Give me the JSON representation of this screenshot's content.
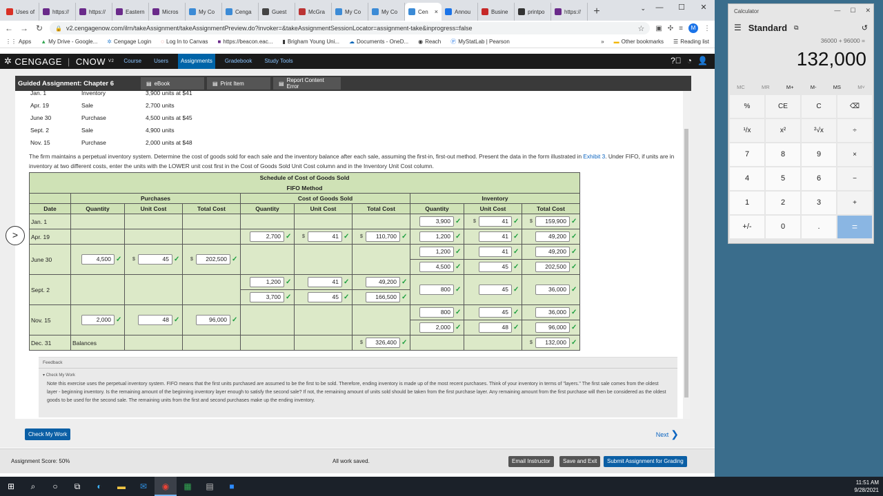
{
  "browser": {
    "tabs": [
      {
        "label": "Uses of",
        "color": "#d93025"
      },
      {
        "label": "https://",
        "color": "#6a2a8a"
      },
      {
        "label": "https://",
        "color": "#6a2a8a"
      },
      {
        "label": "Eastern",
        "color": "#6a2a8a"
      },
      {
        "label": "Micros",
        "color": "#6a2a8a"
      },
      {
        "label": "My Co",
        "color": "#3c8bd6"
      },
      {
        "label": "Cenga",
        "color": "#3c8bd6"
      },
      {
        "label": "Guest",
        "color": "#444"
      },
      {
        "label": "McGra",
        "color": "#b33"
      },
      {
        "label": "My Co",
        "color": "#3c8bd6"
      },
      {
        "label": "My Co",
        "color": "#3c8bd6"
      },
      {
        "label": "Cen",
        "color": "#3c8bd6",
        "active": true
      },
      {
        "label": "Annou",
        "color": "#1a73e8"
      },
      {
        "label": "Busine",
        "color": "#c62828"
      },
      {
        "label": "printpo",
        "color": "#333"
      },
      {
        "label": "https://",
        "color": "#6a2a8a"
      }
    ],
    "url": "v2.cengagenow.com/ilrn/takeAssignment/takeAssignmentPreview.do?invoker=&takeAssignmentSessionLocator=assignment-take&inprogress=false",
    "profile_initial": "M",
    "bookmarks": [
      "Apps",
      "My Drive - Google...",
      "Cengage Login",
      "Log In to Canvas",
      "https://beacon.eac...",
      "Brigham Young Uni...",
      "Documents - OneD...",
      "Reach",
      "MyStatLab | Pearson"
    ],
    "other_bookmarks": "Other bookmarks",
    "reading_list": "Reading list"
  },
  "cengage": {
    "logo": "CENGAGE",
    "logo2": "CNOW",
    "logo2_sup": "V2",
    "nav": [
      "Course",
      "Users",
      "Assignments",
      "Gradebook",
      "Study Tools"
    ],
    "active_nav": "Assignments",
    "assignment_title": "Guided Assignment: Chapter 6",
    "ebook": "eBook",
    "print_item": "Print Item",
    "report_error": "Report Content Error"
  },
  "transactions": [
    {
      "date": "Jan. 1",
      "type": "Inventory",
      "detail": "3,900 units at $41"
    },
    {
      "date": "Apr. 19",
      "type": "Sale",
      "detail": "2,700 units"
    },
    {
      "date": "June 30",
      "type": "Purchase",
      "detail": "4,500 units at $45"
    },
    {
      "date": "Sept. 2",
      "type": "Sale",
      "detail": "4,900 units"
    },
    {
      "date": "Nov. 15",
      "type": "Purchase",
      "detail": "2,000 units at $48"
    }
  ],
  "instructions": {
    "text1": "The firm maintains a perpetual inventory system. Determine the cost of goods sold for each sale and the inventory balance after each sale, assuming the first-in, first-out method. Present the data in the form illustrated in ",
    "link": "Exhibit 3",
    "text2": ". Under FIFO, if units are in inventory at two different costs, enter the units with the LOWER unit cost first in the Cost of Goods Sold Unit Cost column and in the Inventory Unit Cost column."
  },
  "schedule": {
    "title": "Schedule of Cost of Goods Sold",
    "subtitle": "FIFO Method",
    "groups": [
      "Purchases",
      "Cost of Goods Sold",
      "Inventory"
    ],
    "columns": [
      "Date",
      "Quantity",
      "Unit Cost",
      "Total Cost",
      "Quantity",
      "Unit Cost",
      "Total Cost",
      "Quantity",
      "Unit Cost",
      "Total Cost"
    ],
    "dollar": "$",
    "check": "✓",
    "jan1": {
      "date": "Jan. 1",
      "inv_qty": "3,900",
      "inv_uc": "41",
      "inv_tc": "159,900"
    },
    "apr19": {
      "date": "Apr. 19",
      "cogs_qty": "2,700",
      "cogs_uc": "41",
      "cogs_tc": "110,700",
      "inv_qty": "1,200",
      "inv_uc": "41",
      "inv_tc": "49,200"
    },
    "jun30": {
      "date": "June 30",
      "p_qty": "4,500",
      "p_uc": "45",
      "p_tc": "202,500",
      "inv1_qty": "1,200",
      "inv1_uc": "41",
      "inv1_tc": "49,200",
      "inv2_qty": "4,500",
      "inv2_uc": "45",
      "inv2_tc": "202,500"
    },
    "sep2": {
      "date": "Sept. 2",
      "c1_qty": "1,200",
      "c1_uc": "41",
      "c1_tc": "49,200",
      "c2_qty": "3,700",
      "c2_uc": "45",
      "c2_tc": "166,500",
      "inv_qty": "800",
      "inv_uc": "45",
      "inv_tc": "36,000"
    },
    "nov15": {
      "date": "Nov. 15",
      "p_qty": "2,000",
      "p_uc": "48",
      "p_tc": "96,000",
      "inv1_qty": "800",
      "inv1_uc": "45",
      "inv1_tc": "36,000",
      "inv2_qty": "2,000",
      "inv2_uc": "48",
      "inv2_tc": "96,000"
    },
    "dec31": {
      "date": "Dec. 31",
      "label": "Balances",
      "cogs_tc": "326,400",
      "inv_tc": "132,000"
    }
  },
  "feedback": {
    "header": "Feedback",
    "check_label": "Check My Work",
    "text": "Note this exercise uses the perpetual inventory system. FIFO means that the first units purchased are assumed to be the first to be sold. Therefore, ending inventory is made up of the most recent purchases. Think of your inventory in terms of \"layers.\" The first sale comes from the oldest layer - beginning inventory. Is the remaining amount of the beginning inventory layer enough to satisfy the second sale? If not, the remaining amount of units sold should be taken from the first purchase layer. Any remaining amount from the first purchase will then be considered as the oldest goods to be used for the second sale. The remaining units from the first and second purchases make up the ending inventory."
  },
  "footer": {
    "check_my_work": "Check My Work",
    "next": "Next",
    "score": "Assignment Score: 50%",
    "saved": "All work saved.",
    "email": "Email Instructor",
    "save_exit": "Save and Exit",
    "submit": "Submit Assignment for Grading"
  },
  "calculator": {
    "title": "Calculator",
    "mode": "Standard",
    "expression": "36000 + 96000 =",
    "display": "132,000",
    "memory": [
      "MC",
      "MR",
      "M+",
      "M-",
      "MS",
      "M˅"
    ],
    "keys": [
      "%",
      "CE",
      "C",
      "⌫",
      "¹/x",
      "x²",
      "²√x",
      "÷",
      "7",
      "8",
      "9",
      "×",
      "4",
      "5",
      "6",
      "−",
      "1",
      "2",
      "3",
      "+",
      "+/-",
      "0",
      ".",
      "="
    ]
  },
  "taskbar": {
    "time": "11:51 AM",
    "date": "9/28/2021"
  }
}
